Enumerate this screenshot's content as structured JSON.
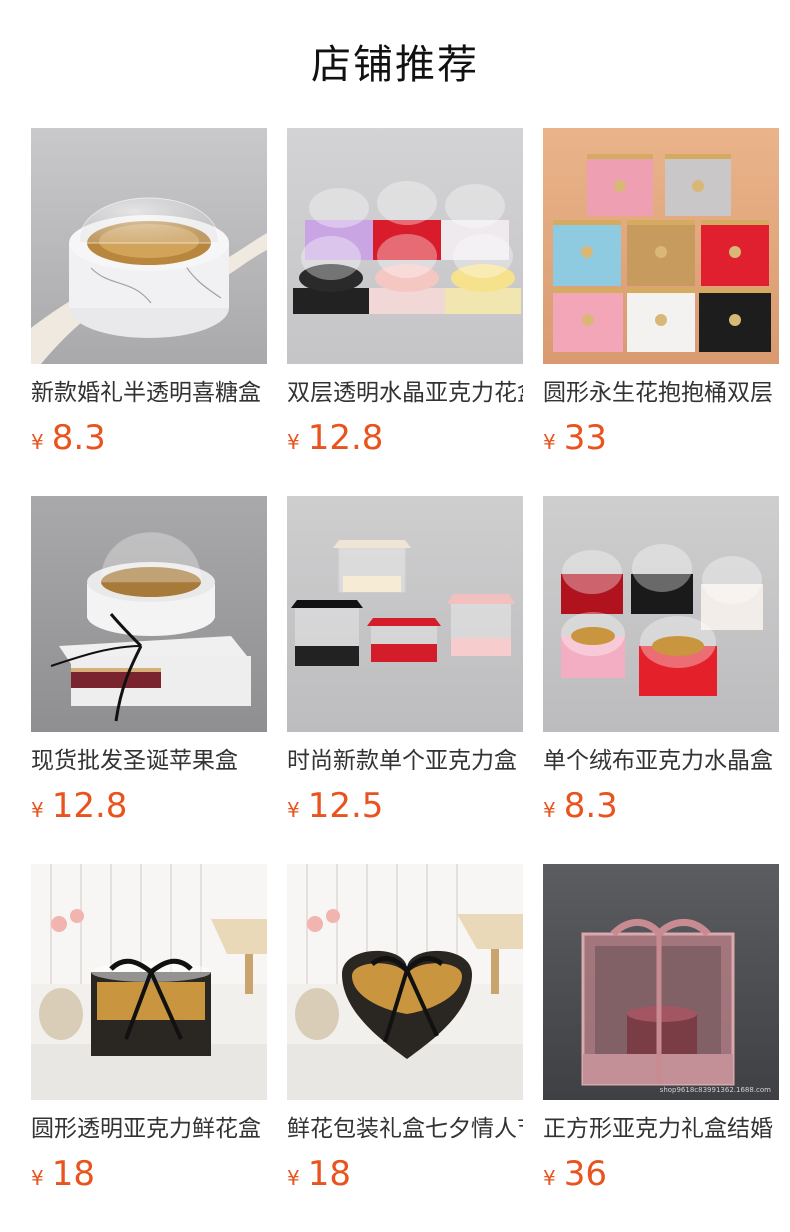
{
  "page_title": "店铺推荐",
  "currency_symbol": "¥",
  "accent_color": "#e8531e",
  "products": [
    {
      "name": "新款婚礼半透明喜糖盒",
      "price": "8.3",
      "image": "white-marble-dome-box"
    },
    {
      "name": "双层透明水晶亚克力花盒",
      "price": "12.8",
      "image": "double-layer-dome-boxes"
    },
    {
      "name": "圆形永生花抱抱桶双层",
      "price": "33",
      "image": "round-flower-buckets"
    },
    {
      "name": "现货批发圣诞苹果盒",
      "price": "12.8",
      "image": "marble-dome-drawer-box"
    },
    {
      "name": "时尚新款单个亚克力盒",
      "price": "12.5",
      "image": "square-acrylic-boxes"
    },
    {
      "name": "单个绒布亚克力水晶盒",
      "price": "8.3",
      "image": "velvet-dome-boxes"
    },
    {
      "name": "圆形透明亚克力鲜花盒",
      "price": "18",
      "image": "round-black-ribbon-box"
    },
    {
      "name": "鲜花包装礼盒七夕情人节",
      "price": "18",
      "image": "heart-black-ribbon-box"
    },
    {
      "name": "正方形亚克力礼盒结婚",
      "price": "36",
      "image": "pink-square-acrylic-box"
    }
  ],
  "watermark_text": "shop9618c83991362.1688.com"
}
